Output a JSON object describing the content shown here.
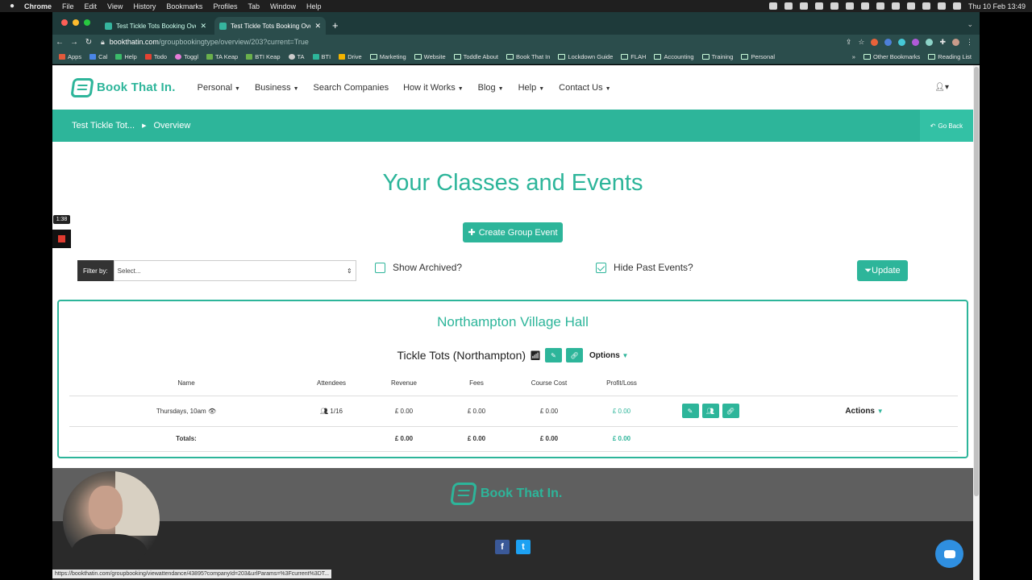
{
  "mac": {
    "app_name": "Chrome",
    "menus": [
      "File",
      "Edit",
      "View",
      "History",
      "Bookmarks",
      "Profiles",
      "Tab",
      "Window",
      "Help"
    ],
    "datetime": "Thu 10 Feb  13:49"
  },
  "browser": {
    "tabs": [
      {
        "title": "Test Tickle Tots Booking Overv"
      },
      {
        "title": "Test Tickle Tots Booking Overv"
      }
    ],
    "url_host": "bookthatin.com",
    "url_path": "/groupbookingtype/overview/203?current=True",
    "bookmarks": [
      "Apps",
      "Cal",
      "Help",
      "Todo",
      "Toggl",
      "TA Keap",
      "BTI Keap",
      "TA",
      "BTI",
      "Drive",
      "Marketing",
      "Website",
      "Toddle About",
      "Book That In",
      "Lockdown Guide",
      "FLAH",
      "Accounting",
      "Training",
      "Personal"
    ],
    "bookmarks_more": "»",
    "other_bookmarks": "Other Bookmarks",
    "reading_list": "Reading List",
    "status_url": "https://bookthatin.com/groupbooking/viewattendance/43895?companyId=203&urlParams=%3Fcurrent%3DT..."
  },
  "site": {
    "logo_text": "Book That In.",
    "nav": [
      "Personal",
      "Business",
      "Search Companies",
      "How it Works",
      "Blog",
      "Help",
      "Contact Us"
    ],
    "breadcrumb": [
      "Test Tickle Tot...",
      "Overview"
    ],
    "go_back": "Go Back",
    "heading": "Your Classes and Events",
    "create_button": "Create Group Event",
    "filter_label": "Filter by:",
    "filter_value": "Select...",
    "show_archived": "Show Archived?",
    "hide_past": "Hide Past Events?",
    "hide_past_checked": true,
    "update_button": "Update"
  },
  "venue": {
    "name": "Northampton Village Hall",
    "class_title": "Tickle Tots (Northampton)",
    "options_label": "Options"
  },
  "table": {
    "headers": [
      "Name",
      "Attendees",
      "Revenue",
      "Fees",
      "Course Cost",
      "Profit/Loss"
    ],
    "rows": [
      {
        "name": "Thursdays, 10am",
        "attendees": "1/16",
        "revenue": "£ 0.00",
        "fees": "£ 0.00",
        "course_cost": "£ 0.00",
        "profit": "£ 0.00",
        "actions": "Actions"
      }
    ],
    "totals": {
      "label": "Totals:",
      "revenue": "£ 0.00",
      "fees": "£ 0.00",
      "course_cost": "£ 0.00",
      "profit": "£ 0.00"
    }
  },
  "recorder": {
    "timer": "1:38"
  },
  "colors": {
    "brand": "#2db59a",
    "tab_bg": "#2b4d4c"
  }
}
